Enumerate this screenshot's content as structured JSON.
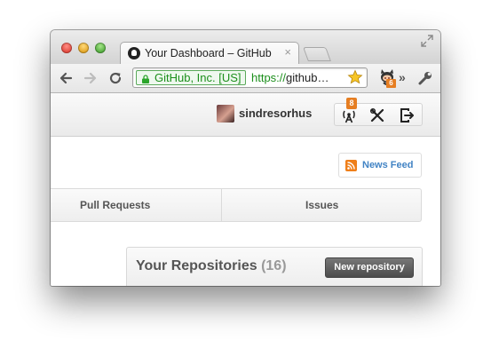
{
  "browser": {
    "tab_title": "Your Dashboard – GitHub",
    "tab_close": "×",
    "ev_label": "GitHub, Inc. [US]",
    "url_scheme": "https://",
    "url_rest": "github…",
    "extension_badge": "6",
    "overflow_chevrons": "»"
  },
  "header": {
    "username": "sindresorhus",
    "notifications_count": "8"
  },
  "dashboard": {
    "news_feed": "News Feed",
    "tabs": [
      "Pull Requests",
      "Issues"
    ],
    "repos_title": "Your Repositories",
    "repos_count": "(16)",
    "new_repo_button": "New repository"
  },
  "colors": {
    "secure_green": "#1c8f1c",
    "badge_orange": "#e67e22",
    "link_blue": "#4183c4"
  }
}
